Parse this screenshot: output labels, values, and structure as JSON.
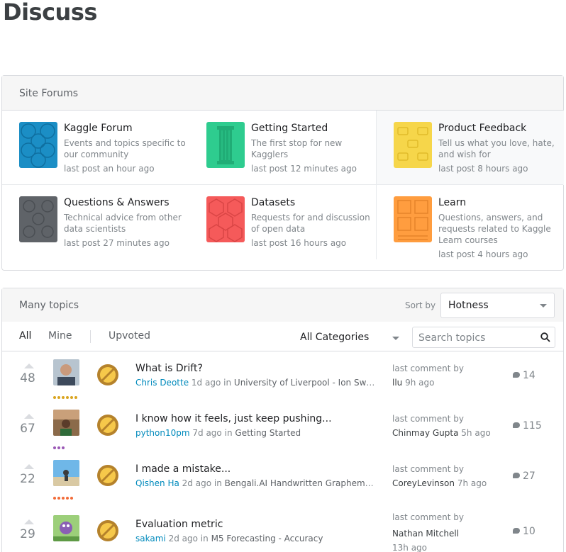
{
  "page": {
    "title": "Discuss"
  },
  "forums": {
    "header": "Site Forums",
    "items": [
      {
        "name": "Kaggle Forum",
        "desc": "Events and topics specific to our community",
        "last": "last post an hour ago",
        "icon": "kaggle-forum-icon",
        "color": "#1b8ec5"
      },
      {
        "name": "Getting Started",
        "desc": "The first stop for new Kagglers",
        "last": "last post 12 minutes ago",
        "icon": "getting-started-icon",
        "color": "#2ecc8f"
      },
      {
        "name": "Product Feedback",
        "desc": "Tell us what you love, hate, and wish for",
        "last": "last post 8 hours ago",
        "icon": "product-feedback-icon",
        "color": "#f6d64a"
      },
      {
        "name": "Questions & Answers",
        "desc": "Technical advice from other data scientists",
        "last": "last post 27 minutes ago",
        "icon": "questions-answers-icon",
        "color": "#5f6368"
      },
      {
        "name": "Datasets",
        "desc": "Requests for and discussion of open data",
        "last": "last post 16 hours ago",
        "icon": "datasets-icon",
        "color": "#f55a5a"
      },
      {
        "name": "Learn",
        "desc": "Questions, answers, and requests related to Kaggle Learn courses",
        "last": "last post 4 hours ago",
        "icon": "learn-icon",
        "color": "#ff9d3f"
      }
    ]
  },
  "topics": {
    "header": "Many topics",
    "sort_label": "Sort by",
    "sort_value": "Hotness",
    "tabs": [
      "All",
      "Mine",
      "Upvoted"
    ],
    "category_value": "All Categories",
    "search_placeholder": "Search topics",
    "last_comment_label": "last comment by",
    "rows": [
      {
        "votes": "48",
        "title": "What is Drift?",
        "author": "Chris Deotte",
        "time": "1d ago",
        "in": "in",
        "forum": "University of Liverpool - Ion Switc...",
        "lc_user": "llu",
        "lc_time": "9h ago",
        "comments": "14",
        "tier_color": "#daa520"
      },
      {
        "votes": "67",
        "title": "I know how it feels, just keep pushing...",
        "author": "python10pm",
        "time": "7d ago",
        "in": "in",
        "forum": "Getting Started",
        "lc_user": "Chinmay Gupta",
        "lc_time": "5h ago",
        "comments": "115",
        "tier_color": "#9b59b6"
      },
      {
        "votes": "22",
        "title": "I made a mistake...",
        "author": "Qishen Ha",
        "time": "2d ago",
        "in": "in",
        "forum": "Bengali.AI Handwritten Grapheme Cl...",
        "lc_user": "CoreyLevinson",
        "lc_time": "7h ago",
        "comments": "27",
        "tier_color": "#f26b38"
      },
      {
        "votes": "29",
        "title": "Evaluation metric",
        "author": "sakami",
        "time": "2d ago",
        "in": "in",
        "forum": "M5 Forecasting - Accuracy",
        "lc_user": "Nathan Mitchell",
        "lc_time": "13h ago",
        "comments": "10",
        "tier_color": "#f26b38"
      }
    ]
  }
}
